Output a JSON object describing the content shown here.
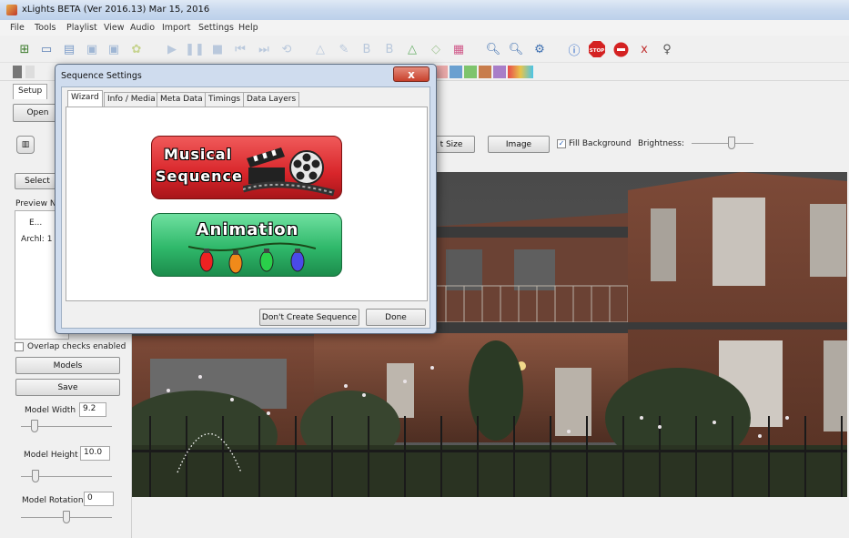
{
  "window": {
    "title": "xLights BETA (Ver 2016.13) Mar 15, 2016"
  },
  "menu": [
    "File",
    "Tools",
    "Playlist",
    "View",
    "Audio",
    "Import",
    "Settings",
    "Help"
  ],
  "main_tabs": [
    "Setup",
    "Open"
  ],
  "left_panel": {
    "select_button": "Select",
    "preview_label": "Preview N",
    "list_items": [
      "E...",
      "Archl: 1"
    ],
    "overlap_checkbox": "Overlap checks enabled",
    "models_button": "Models",
    "save_button": "Save",
    "model_width_label": "Model Width",
    "model_width_value": "9.2",
    "model_height_label": "Model Height",
    "model_height_value": "10.0",
    "model_rotation_label": "Model Rotation",
    "model_rotation_value": "0"
  },
  "preview_toolbar": {
    "set_size_button": "t Size",
    "image_button": "Image",
    "fill_background_label": "Fill Background",
    "brightness_label": "Brightness:"
  },
  "dialog": {
    "title": "Sequence Settings",
    "close_glyph": "x",
    "tabs": [
      "Wizard",
      "Info / Media",
      "Meta Data",
      "Timings",
      "Data Layers"
    ],
    "musical_line1": "Musical",
    "musical_line2": "Sequence",
    "animation_label": "Animation",
    "dont_create_button": "Don't Create Sequence",
    "done_button": "Done"
  },
  "colors": {
    "musical_red": "#d8252a",
    "animation_green": "#2fb86a",
    "dialog_frame": "#cfdcee"
  }
}
